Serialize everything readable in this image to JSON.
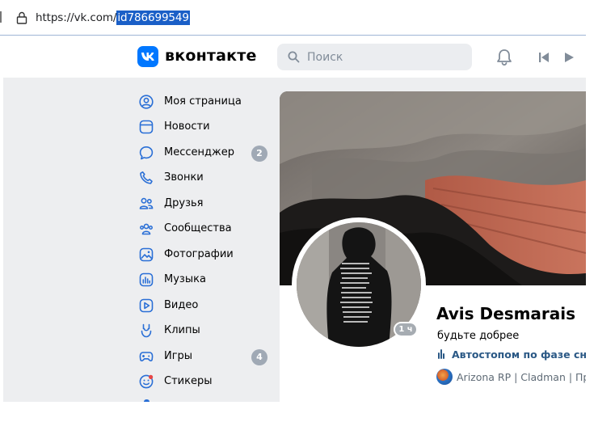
{
  "browser": {
    "url_prefix": "https://vk.com/",
    "url_selected": "id786699549"
  },
  "header": {
    "logo_text": "вконтакте",
    "search_placeholder": "Поиск"
  },
  "sidebar": {
    "items": [
      {
        "label": "Моя страница",
        "icon": "user-circle-icon"
      },
      {
        "label": "Новости",
        "icon": "news-icon"
      },
      {
        "label": "Мессенджер",
        "icon": "message-icon",
        "badge": "2"
      },
      {
        "label": "Звонки",
        "icon": "phone-icon"
      },
      {
        "label": "Друзья",
        "icon": "friends-icon"
      },
      {
        "label": "Сообщества",
        "icon": "communities-icon"
      },
      {
        "label": "Фотографии",
        "icon": "photo-icon"
      },
      {
        "label": "Музыка",
        "icon": "music-icon"
      },
      {
        "label": "Видео",
        "icon": "video-icon"
      },
      {
        "label": "Клипы",
        "icon": "clips-icon"
      },
      {
        "label": "Игры",
        "icon": "games-icon",
        "badge": "4"
      },
      {
        "label": "Стикеры",
        "icon": "stickers-icon"
      }
    ]
  },
  "profile": {
    "name": "Avis Desmarais",
    "status": "будьте добрее",
    "music_text": "Автостопом по фазе сна",
    "group_text": "Arizona RP | Cladman | Про",
    "online_badge": "1 ч"
  },
  "colors": {
    "vk_blue": "#0077ff",
    "link": "#2a5885",
    "page_bg": "#edeef0",
    "badge_gray": "#a0a9b5"
  }
}
